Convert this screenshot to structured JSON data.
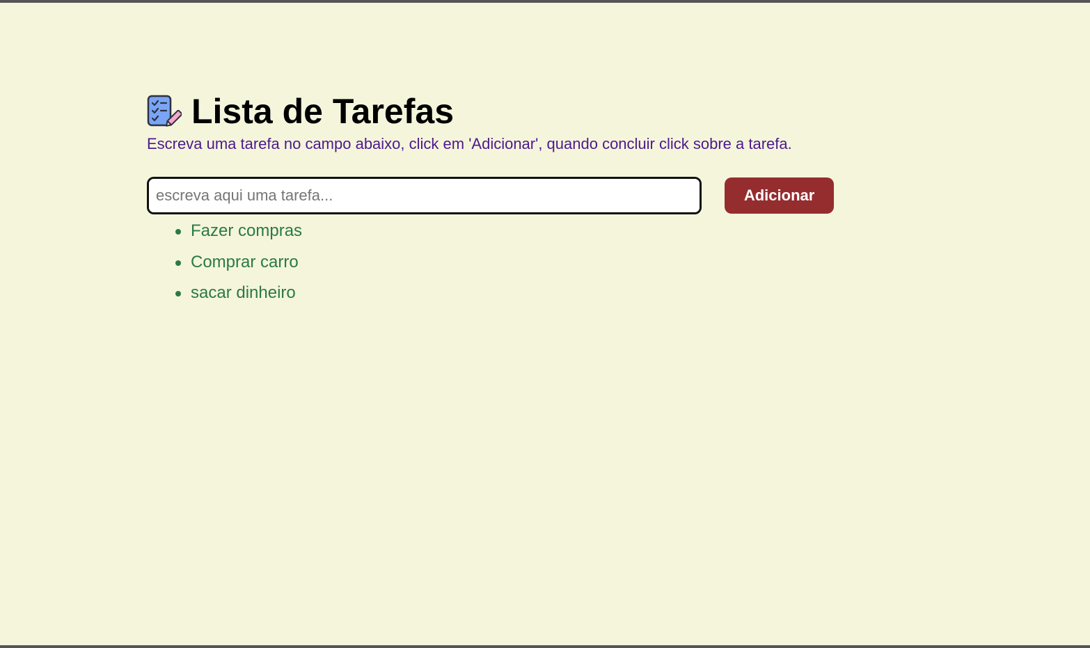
{
  "header": {
    "icon": "checklist-pencil-icon",
    "title": "Lista de Tarefas",
    "subtitle": "Escreva uma tarefa no campo abaixo, click em 'Adicionar', quando concluir click sobre a tarefa."
  },
  "form": {
    "input_value": "",
    "input_placeholder": "escreva aqui uma tarefa...",
    "add_label": "Adicionar"
  },
  "tasks": [
    {
      "label": "Fazer compras"
    },
    {
      "label": "Comprar carro"
    },
    {
      "label": "sacar dinheiro"
    }
  ],
  "colors": {
    "background": "#f5f5dc",
    "subtitle": "#4b1a8c",
    "button": "#952d2f",
    "task": "#2a7a42",
    "icon_fill": "#7aa5f5"
  }
}
